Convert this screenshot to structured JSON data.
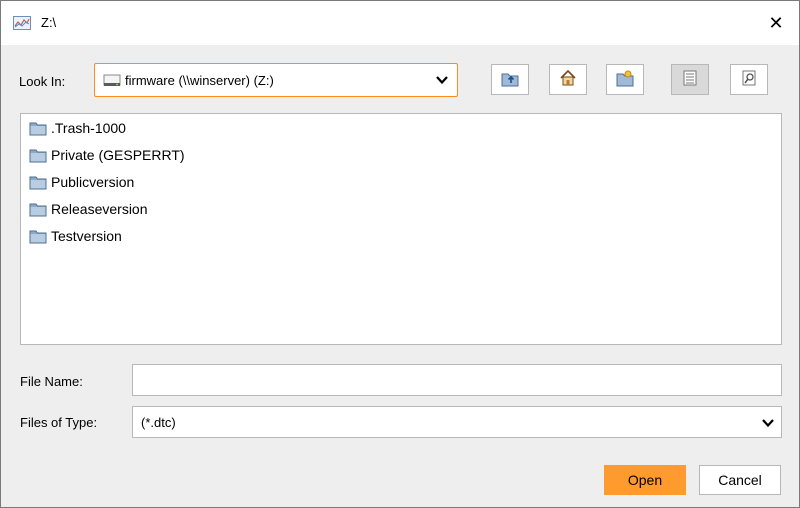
{
  "window": {
    "title": "Z:\\",
    "close_glyph": "✕",
    "icon": "chart-app-icon"
  },
  "look_in": {
    "label": "Look In:",
    "mnemonic": "L",
    "value": "firmware (\\\\winserver) (Z:)",
    "drive_icon": "network-drive-icon"
  },
  "toolbar": {
    "buttons": [
      {
        "name": "up-one-level",
        "icon": "folder-up-icon"
      },
      {
        "name": "home",
        "icon": "home-icon"
      },
      {
        "name": "create-new-folder",
        "icon": "new-folder-icon"
      },
      {
        "name": "list-view",
        "icon": "list-view-icon",
        "selected": true
      },
      {
        "name": "details-view",
        "icon": "details-view-icon",
        "selected": false
      }
    ]
  },
  "files": [
    {
      "name": ".Trash-1000"
    },
    {
      "name": "Private (GESPERRT)"
    },
    {
      "name": "Publicversion"
    },
    {
      "name": "Releaseversion"
    },
    {
      "name": "Testversion"
    }
  ],
  "file_name": {
    "label": "File Name:",
    "mnemonic": "N",
    "value": ""
  },
  "files_of_type": {
    "label": "Files of Type:",
    "mnemonic": "T",
    "value": "(*.dtc)"
  },
  "buttons": {
    "open": "Open",
    "cancel": "Cancel"
  },
  "colors": {
    "accent": "#ff9a2e",
    "focus_border": "#ff8c1a",
    "panel": "#eeeeee"
  }
}
